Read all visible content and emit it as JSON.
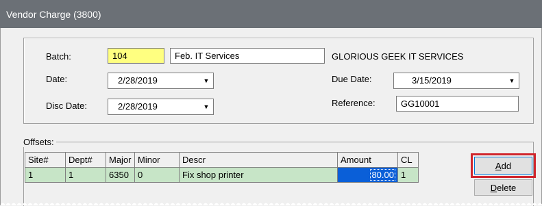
{
  "window": {
    "title": "Vendor Charge (3800)"
  },
  "header": {
    "batch_label": "Batch:",
    "batch_value": "104",
    "batch_desc": "Feb. IT Services",
    "vendor_name": "GLORIOUS GEEK IT SERVICES",
    "date_label": "Date:",
    "date_value": "2/28/2019",
    "due_date_label": "Due Date:",
    "due_date_value": "3/15/2019",
    "disc_date_label": "Disc Date:",
    "disc_date_value": "2/28/2019",
    "reference_label": "Reference:",
    "reference_value": "GG10001"
  },
  "offsets": {
    "label": "Offsets:",
    "columns": [
      "Site#",
      "Dept#",
      "Major",
      "Minor",
      "Descr",
      "Amount",
      "CL"
    ],
    "rows": [
      {
        "site": "1",
        "dept": "1",
        "major": "6350",
        "minor": "0",
        "descr": "Fix shop printer",
        "amount": "80.00",
        "cl": "1"
      }
    ]
  },
  "buttons": {
    "add": "Add",
    "delete": "Delete"
  },
  "colors": {
    "titlebar": "#6b7076",
    "batch_bg": "#ffff80",
    "row_bg": "#c7e5c7",
    "selected_cell": "#0a5fd8",
    "highlight_border": "#d0262d"
  }
}
